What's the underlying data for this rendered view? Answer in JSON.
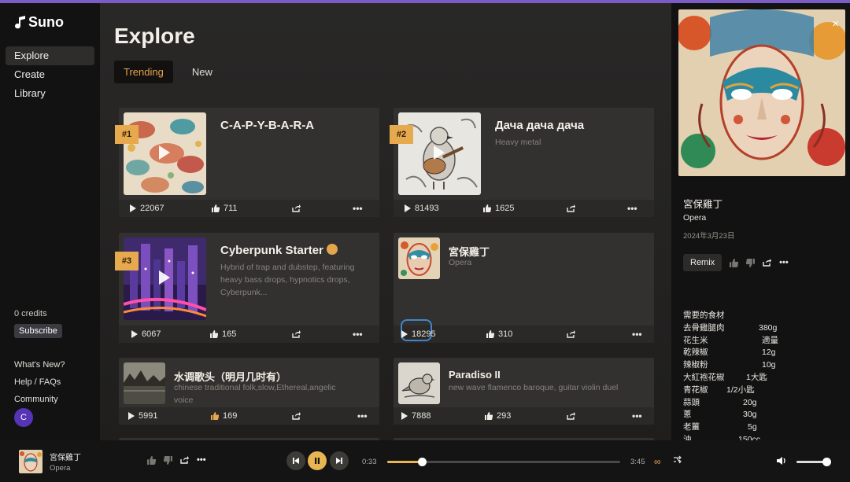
{
  "app": {
    "logo_text": "Suno"
  },
  "sidebar": {
    "nav": [
      {
        "label": "Explore",
        "active": true
      },
      {
        "label": "Create",
        "active": false
      },
      {
        "label": "Library",
        "active": false
      }
    ],
    "credits": "0 credits",
    "subscribe_label": "Subscribe",
    "links": [
      "What's New?",
      "Help / FAQs",
      "Community"
    ],
    "avatar_letter": "C"
  },
  "main": {
    "title": "Explore",
    "tabs": [
      {
        "label": "Trending",
        "active": true
      },
      {
        "label": "New",
        "active": false
      }
    ],
    "cards": [
      {
        "rank": "#1",
        "title": "C-A-P-Y-B-A-R-A",
        "subtitle": "",
        "plays": "22067",
        "likes": "711"
      },
      {
        "rank": "#2",
        "title": "Дача дача дача",
        "subtitle": "Heavy metal",
        "plays": "81493",
        "likes": "1625"
      },
      {
        "rank": "#3",
        "title": "Cyberpunk Starter",
        "subtitle": "Hybrid of trap and dubstep, featuring heavy bass drops, hypnotics drops, Cyberpunk...",
        "plays": "6067",
        "likes": "165"
      },
      {
        "rank": "",
        "title": "宮保雞丁",
        "subtitle": "Opera",
        "plays": "18295",
        "likes": "310"
      },
      {
        "rank": "",
        "title": "水调歌头（明月几时有）",
        "subtitle": "chinese traditional folk,slow,Ethereal,angelic voice",
        "plays": "5991",
        "likes": "169"
      },
      {
        "rank": "",
        "title": "Paradiso II",
        "subtitle": "new wave flamenco baroque, guitar violin duel",
        "plays": "7888",
        "likes": "293"
      }
    ]
  },
  "detail": {
    "close_icon": "×",
    "title": "宮保雞丁",
    "genre": "Opera",
    "date": "2024年3月23日",
    "remix_label": "Remix",
    "lyrics": [
      {
        "name": "需要的食材",
        "qty": ""
      },
      {
        "name": "去骨雞腿肉",
        "qty": "380g"
      },
      {
        "name": "花生米",
        "qty": "適量"
      },
      {
        "name": "乾辣椒",
        "qty": "12g"
      },
      {
        "name": "辣椒粉",
        "qty": "10g"
      },
      {
        "name": "大紅袍花椒",
        "qty": "1大匙"
      },
      {
        "name": "青花椒",
        "qty": "1/2小匙"
      },
      {
        "name": "蒜頭",
        "qty": "20g"
      },
      {
        "name": "蔥",
        "qty": "30g"
      },
      {
        "name": "老薑",
        "qty": "5g"
      },
      {
        "name": "油",
        "qty": "150cc"
      }
    ]
  },
  "player": {
    "title": "宮保雞丁",
    "genre": "Opera",
    "elapsed": "0:33",
    "duration": "3:45",
    "progress": 0.147,
    "volume": 0.9,
    "loop_icon": "∞"
  },
  "colors": {
    "accent": "#e7a94e",
    "brand_line": "#7b5cc7",
    "play_button": "#e7b552"
  }
}
